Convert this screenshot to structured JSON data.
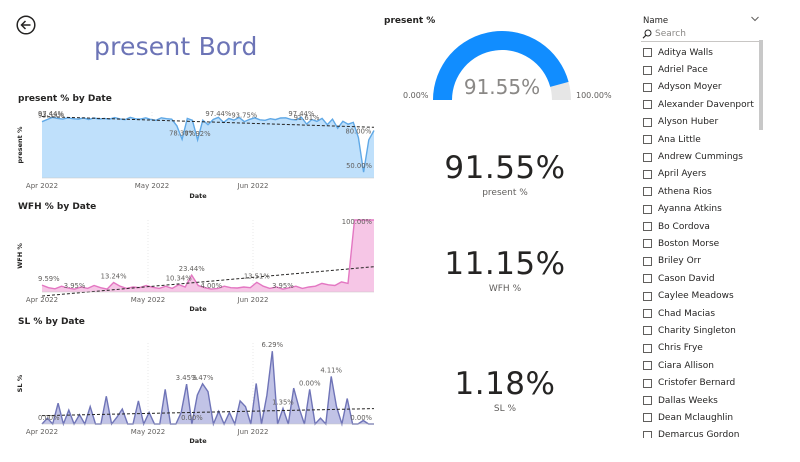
{
  "page_title": "present Bord",
  "icons": {
    "back": "arrow-left-circle-icon",
    "search": "search-icon",
    "chevron": "chevron-down-icon"
  },
  "colors": {
    "title": "#6c74b6",
    "present": "#5fa8e6",
    "present_fill": "#bfe0fb",
    "wfh": "#e377c2",
    "wfh_fill": "#f6c6e6",
    "sl": "#6f74b7",
    "sl_fill": "#c1c3e6",
    "gauge": "#118dff",
    "gauge_track": "#e6e6e6"
  },
  "charts": [
    {
      "id": "present",
      "title": "present % by Date",
      "ylabel": "present %",
      "xlabel": "Date",
      "tick_labels": [
        "Apr 2022",
        "May 2022",
        "Jun 2022"
      ],
      "data_labels": [
        "93.59%",
        "97.44%",
        "78.38%",
        "77.92%",
        "97.44%",
        "93.75%",
        "97.44%",
        "91.61%",
        "80.00%",
        "50.00%"
      ]
    },
    {
      "id": "wfh",
      "title": "WFH % by Date",
      "ylabel": "WFH %",
      "xlabel": "Date",
      "tick_labels": [
        "Apr 2022",
        "May 2022",
        "Jun 2022"
      ],
      "data_labels": [
        "9.59%",
        "3.95%",
        "13.24%",
        "10.34%",
        "23.44%",
        "4.00%",
        "13.51%",
        "3.95%",
        "100.00%"
      ]
    },
    {
      "id": "sl",
      "title": "SL % by Date",
      "ylabel": "SL %",
      "xlabel": "Date",
      "tick_labels": [
        "Apr 2022",
        "May 2022",
        "Jun 2022"
      ],
      "data_labels": [
        "0.00%",
        "3.45%",
        "3.47%",
        "0.00%",
        "6.29%",
        "1.35%",
        "0.00%",
        "4.11%",
        "0.00%"
      ]
    }
  ],
  "chart_data": [
    {
      "type": "area",
      "title": "present % by Date",
      "xlabel": "Date",
      "ylabel": "present %",
      "x_range": [
        "2022-04-01",
        "2022-07-05"
      ],
      "ylim": [
        45,
        102
      ],
      "trendline": true,
      "values": [
        93.59,
        95.5,
        97.44,
        96.5,
        95.9,
        97.0,
        96.2,
        95.8,
        96.9,
        95.5,
        96.8,
        95.9,
        96.5,
        95.8,
        97.2,
        96.0,
        95.4,
        97.3,
        96.1,
        95.9,
        97.0,
        95.5,
        94.8,
        97.0,
        96.2,
        95.8,
        90.0,
        78.38,
        96.5,
        94.8,
        77.92,
        95.0,
        91.0,
        95.5,
        97.44,
        93.0,
        96.5,
        95.0,
        97.3,
        93.75,
        95.6,
        97.0,
        95.3,
        94.8,
        96.2,
        95.4,
        96.8,
        97.0,
        95.6,
        95.2,
        97.44,
        91.61,
        95.5,
        94.0,
        96.5,
        91.0,
        95.8,
        88.0,
        94.0,
        91.5,
        93.0,
        80.0,
        50.0,
        78.0,
        86.0
      ],
      "labels": [
        {
          "text": "93.59%",
          "x_index": 0
        },
        {
          "text": "97.44%",
          "x_index": 2
        },
        {
          "text": "78.38%",
          "x_index": 27
        },
        {
          "text": "77.92%",
          "x_index": 30
        },
        {
          "text": "97.44%",
          "x_index": 34
        },
        {
          "text": "93.75%",
          "x_index": 39
        },
        {
          "text": "97.44%",
          "x_index": 50
        },
        {
          "text": "91.61%",
          "x_index": 51
        },
        {
          "text": "80.00%",
          "x_index": 61
        },
        {
          "text": "50.00%",
          "x_index": 62
        }
      ],
      "x_ticks": [
        "Apr 2022",
        "May 2022",
        "Jun 2022"
      ]
    },
    {
      "type": "area",
      "title": "WFH % by Date",
      "xlabel": "Date",
      "ylabel": "WFH %",
      "x_range": [
        "2022-04-01",
        "2022-07-05"
      ],
      "ylim": [
        0,
        100
      ],
      "trendline": true,
      "values": [
        9.59,
        6.0,
        4.5,
        8.0,
        5.5,
        3.95,
        7.0,
        5.0,
        9.0,
        6.0,
        4.0,
        13.24,
        8.0,
        5.0,
        7.0,
        6.0,
        9.0,
        6.5,
        5.0,
        8.0,
        5.0,
        10.34,
        7.0,
        23.44,
        9.0,
        6.0,
        4.0,
        5.0,
        8.0,
        6.0,
        5.5,
        7.0,
        6.0,
        13.51,
        8.0,
        5.0,
        7.0,
        3.95,
        6.0,
        8.0,
        5.0,
        7.0,
        8.0,
        12.0,
        10.0,
        9.0,
        14.0,
        12.0,
        100.0,
        100.0,
        100.0,
        100.0
      ],
      "labels": [
        {
          "text": "9.59%",
          "x_index": 0
        },
        {
          "text": "3.95%",
          "x_index": 5
        },
        {
          "text": "13.24%",
          "x_index": 11
        },
        {
          "text": "10.34%",
          "x_index": 21
        },
        {
          "text": "23.44%",
          "x_index": 23
        },
        {
          "text": "4.00%",
          "x_index": 26
        },
        {
          "text": "13.51%",
          "x_index": 33
        },
        {
          "text": "3.95%",
          "x_index": 37
        },
        {
          "text": "100.00%",
          "x_index": 50
        }
      ],
      "x_ticks": [
        "Apr 2022",
        "May 2022",
        "Jun 2022"
      ]
    },
    {
      "type": "area",
      "title": "SL % by Date",
      "xlabel": "Date",
      "ylabel": "SL %",
      "x_range": [
        "2022-04-01",
        "2022-07-05"
      ],
      "ylim": [
        0,
        7
      ],
      "trendline": true,
      "values": [
        0.0,
        0.5,
        0.0,
        1.8,
        0.0,
        1.2,
        0.0,
        0.8,
        0.0,
        1.5,
        0.0,
        0.0,
        2.4,
        0.0,
        0.6,
        1.3,
        0.0,
        0.0,
        2.0,
        0.0,
        1.0,
        0.0,
        0.0,
        3.0,
        0.0,
        0.0,
        1.0,
        3.45,
        0.0,
        2.5,
        3.47,
        2.8,
        0.0,
        1.1,
        0.0,
        1.0,
        0.0,
        2.0,
        1.5,
        0.0,
        3.5,
        0.0,
        2.5,
        6.29,
        0.0,
        1.35,
        0.0,
        3.1,
        1.4,
        0.0,
        3.0,
        0.0,
        0.5,
        0.0,
        4.11,
        1.5,
        0.0,
        2.2,
        0.0,
        0.0,
        0.3,
        0.0,
        0.0
      ],
      "labels": [
        {
          "text": "0.00%",
          "x_index": 0
        },
        {
          "text": "3.45%",
          "x_index": 27
        },
        {
          "text": "3.47%",
          "x_index": 30
        },
        {
          "text": "0.00%",
          "x_index": 28
        },
        {
          "text": "6.29%",
          "x_index": 43
        },
        {
          "text": "1.35%",
          "x_index": 45
        },
        {
          "text": "0.00%",
          "x_index": 50
        },
        {
          "text": "4.11%",
          "x_index": 54
        },
        {
          "text": "0.00%",
          "x_index": 61
        }
      ],
      "x_ticks": [
        "Apr 2022",
        "May 2022",
        "Jun 2022"
      ]
    },
    {
      "type": "gauge",
      "title": "present %",
      "value": 91.55,
      "value_label": "91.55%",
      "min_label": "0.00%",
      "max_label": "100.00%",
      "min": 0,
      "max": 100
    }
  ],
  "gauge": {
    "title": "present %",
    "value_label": "91.55%",
    "min_label": "0.00%",
    "max_label": "100.00%"
  },
  "cards": [
    {
      "value": "91.55%",
      "label": "present %"
    },
    {
      "value": "11.15%",
      "label": "WFH %"
    },
    {
      "value": "1.18%",
      "label": "SL %"
    }
  ],
  "slicer": {
    "title": "Name",
    "search_placeholder": "Search",
    "items": [
      "Aditya Walls",
      "Adriel Pace",
      "Adyson Moyer",
      "Alexander Davenport",
      "Alyson Huber",
      "Ana Little",
      "Andrew Cummings",
      "April Ayers",
      "Athena Rios",
      "Ayanna Atkins",
      "Bo Cordova",
      "Boston Morse",
      "Briley Orr",
      "Cason David",
      "Caylee Meadows",
      "Chad Macias",
      "Charity Singleton",
      "Chris Frye",
      "Ciara Allison",
      "Cristofer Bernard",
      "Dallas Weeks",
      "Dean Mclaughlin",
      "Demarcus Gordon"
    ]
  }
}
